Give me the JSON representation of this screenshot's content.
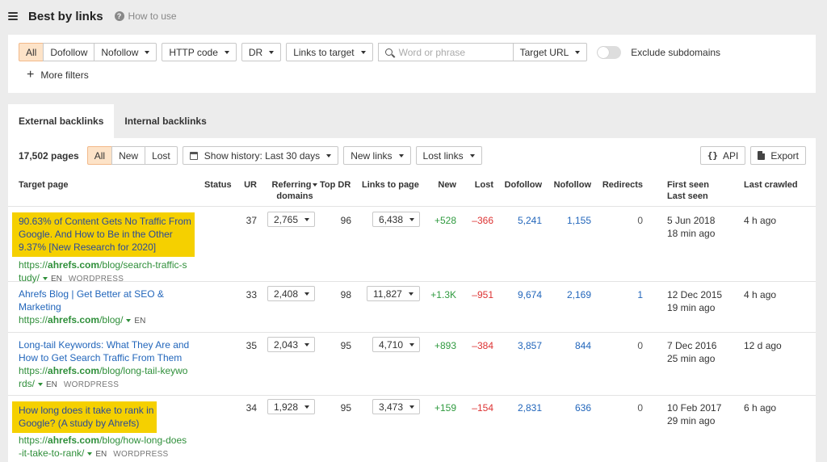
{
  "header": {
    "title": "Best by links",
    "help_label": "How to use"
  },
  "filters": {
    "mode_options": [
      "All",
      "Dofollow",
      "Nofollow"
    ],
    "http_code": "HTTP code",
    "dr": "DR",
    "links_to_target": "Links to target",
    "search_placeholder": "Word or phrase",
    "target_url": "Target URL",
    "exclude_subdomains": "Exclude subdomains",
    "more_filters": "More filters"
  },
  "tabs": [
    "External backlinks",
    "Internal backlinks"
  ],
  "toolbar": {
    "count": "17,502 pages",
    "period_options": [
      "All",
      "New",
      "Lost"
    ],
    "history": "Show history: Last 30 days",
    "new_links": "New links",
    "lost_links": "Lost links",
    "api": "API",
    "export": "Export"
  },
  "columns": {
    "target_page": "Target page",
    "status": "Status",
    "ur": "UR",
    "referring_domains_1": "Referring",
    "referring_domains_2": "domains",
    "top_dr": "Top DR",
    "links_to_page": "Links to page",
    "new": "New",
    "lost": "Lost",
    "dofollow": "Dofollow",
    "nofollow": "Nofollow",
    "redirects": "Redirects",
    "first_seen": "First seen",
    "last_seen": "Last seen",
    "last_crawled": "Last crawled"
  },
  "rows": [
    {
      "title_lines": [
        "90.63% of Content Gets No Traffic From",
        "Google. And How to Be in the Other",
        "9.37% [New Research for 2020]"
      ],
      "url_prefix": "https://",
      "url_domain": "ahrefs.com",
      "url_lines": [
        "/blog/search-traffic-s",
        "tudy/"
      ],
      "lang": "EN",
      "cms": "WORDPRESS",
      "ur": "37",
      "ref_domains": "2,765",
      "top_dr": "96",
      "links_to_page": "6,438",
      "new": "+528",
      "lost": "–366",
      "dofollow": "5,241",
      "nofollow": "1,155",
      "redirects": "0",
      "first_seen": "5 Jun 2018",
      "last_seen": "18 min ago",
      "last_crawled": "4 h ago"
    },
    {
      "title_lines": [
        "Ahrefs Blog | Get Better at SEO &",
        "Marketing"
      ],
      "url_prefix": "https://",
      "url_domain": "ahrefs.com",
      "url_lines": [
        "/blog/"
      ],
      "lang": "EN",
      "cms": "",
      "ur": "33",
      "ref_domains": "2,408",
      "top_dr": "98",
      "links_to_page": "11,827",
      "new": "+1.3K",
      "lost": "–951",
      "dofollow": "9,674",
      "nofollow": "2,169",
      "redirects": "1",
      "first_seen": "12 Dec 2015",
      "last_seen": "19 min ago",
      "last_crawled": "4 h ago"
    },
    {
      "title_lines": [
        "Long-tail Keywords: What They Are and",
        "How to Get Search Traffic From Them"
      ],
      "url_prefix": "https://",
      "url_domain": "ahrefs.com",
      "url_lines": [
        "/blog/long-tail-keywo",
        "rds/"
      ],
      "lang": "EN",
      "cms": "WORDPRESS",
      "ur": "35",
      "ref_domains": "2,043",
      "top_dr": "95",
      "links_to_page": "4,710",
      "new": "+893",
      "lost": "–384",
      "dofollow": "3,857",
      "nofollow": "844",
      "redirects": "0",
      "first_seen": "7 Dec 2016",
      "last_seen": "25 min ago",
      "last_crawled": "12 d ago"
    },
    {
      "title_lines": [
        "How long does it take to rank in",
        "Google? (A study by Ahrefs)"
      ],
      "url_prefix": "https://",
      "url_domain": "ahrefs.com",
      "url_lines": [
        "/blog/how-long-does",
        "-it-take-to-rank/"
      ],
      "lang": "EN",
      "cms": "WORDPRESS",
      "ur": "34",
      "ref_domains": "1,928",
      "top_dr": "95",
      "links_to_page": "3,473",
      "new": "+159",
      "lost": "–154",
      "dofollow": "2,831",
      "nofollow": "636",
      "redirects": "0",
      "first_seen": "10 Feb 2017",
      "last_seen": "29 min ago",
      "last_crawled": "6 h ago"
    }
  ],
  "colors": {
    "highlight": "#f5d000",
    "link": "#2266bb",
    "url": "#2f8f3a",
    "positive": "#2f9a3f",
    "negative": "#d33333",
    "active_filter": "#fde3c8"
  }
}
